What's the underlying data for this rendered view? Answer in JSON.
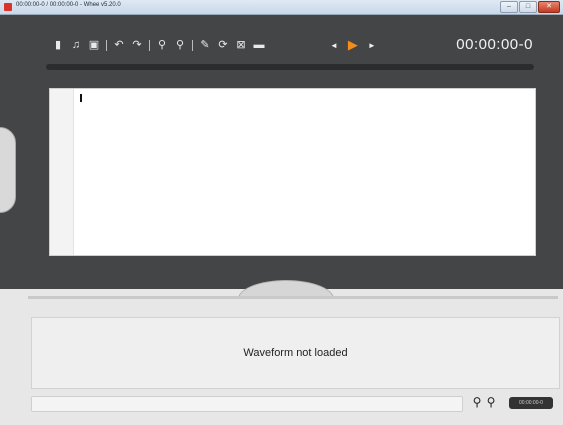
{
  "window": {
    "title": "00:00:00-0 / 00:00:00-0 - Whee v5.20.0",
    "min_glyph": "–",
    "max_glyph": "□",
    "close_glyph": "✕"
  },
  "toolbar": {
    "icons": [
      {
        "name": "new-file-icon",
        "glyph": "▮"
      },
      {
        "name": "music-note-icon",
        "glyph": "♫"
      },
      {
        "name": "save-icon",
        "glyph": "▣"
      },
      {
        "name": "undo-icon",
        "glyph": "↶"
      },
      {
        "name": "redo-icon",
        "glyph": "↷"
      },
      {
        "name": "zoom-in-icon",
        "glyph": "⚲"
      },
      {
        "name": "zoom-out-icon",
        "glyph": "⚲"
      },
      {
        "name": "wand-icon",
        "glyph": "✎"
      },
      {
        "name": "refresh-icon",
        "glyph": "⟳"
      },
      {
        "name": "close-box-icon",
        "glyph": "⊠"
      },
      {
        "name": "keyboard-icon",
        "glyph": "▬"
      }
    ],
    "nav": {
      "prev_glyph": "◄",
      "play_glyph": "▶",
      "next_glyph": "►"
    }
  },
  "player": {
    "time": "00:00:00-0"
  },
  "waveform": {
    "message": "Waveform not loaded"
  },
  "bottom": {
    "zoom_in_glyph": "⚲",
    "zoom_out_glyph": "⚲",
    "time_badge": "00:00:00-0"
  },
  "colors": {
    "accent_play": "#f28c1a",
    "editor_bg": "#444546"
  }
}
